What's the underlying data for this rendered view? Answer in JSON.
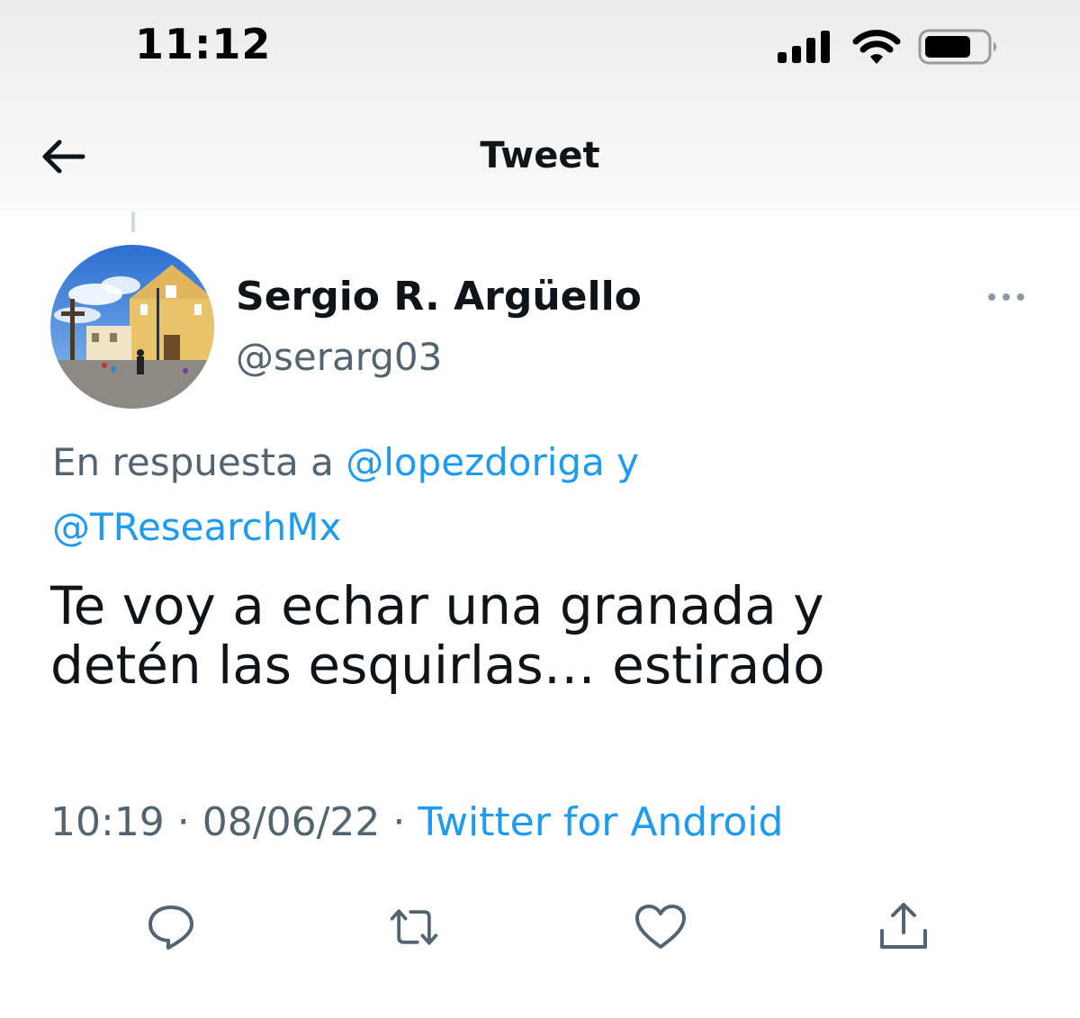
{
  "status_bar": {
    "time": "11:12"
  },
  "header": {
    "title": "Tweet"
  },
  "tweet": {
    "display_name": "Sergio R. Argüello",
    "handle": "@serarg03",
    "reply_prefix": "En respuesta a ",
    "reply_mention_1": "@lopezdoriga",
    "reply_conjunction": " y",
    "reply_mention_2": "@TResearchMx",
    "text_line_1": "Te voy a echar una granada y",
    "text_line_2": "detén las esquirlas… estirado",
    "time": "10:19",
    "separator": " · ",
    "date": "08/06/22",
    "source": "Twitter for Android"
  },
  "icons": {
    "back": "arrow-left-icon",
    "more": "more-dots-icon",
    "reply": "comment-icon",
    "retweet": "retweet-icon",
    "like": "heart-icon",
    "share": "share-icon"
  },
  "colors": {
    "accent": "#1d9bf0",
    "text": "#0f1419",
    "secondary": "#536471"
  }
}
